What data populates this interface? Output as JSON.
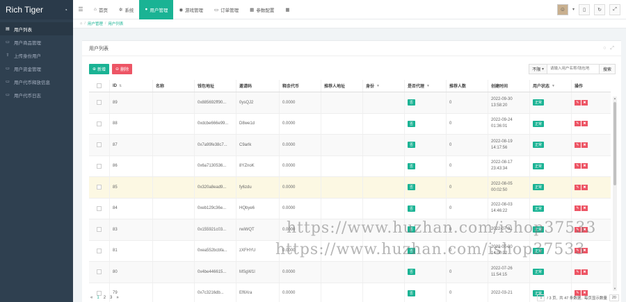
{
  "sidebar": {
    "brand": "Rich Tiger",
    "items": [
      {
        "label": "用户列表",
        "icon": "list-icon",
        "glyph": "▤",
        "active": true
      },
      {
        "label": "用户商品管理",
        "icon": "file-icon",
        "glyph": "▭",
        "active": false
      },
      {
        "label": "上传身份用户",
        "icon": "upload-icon",
        "glyph": "⇧",
        "active": false
      },
      {
        "label": "用户资金管理",
        "icon": "wallet-icon",
        "glyph": "▭",
        "active": false
      },
      {
        "label": "用户代币释放信息",
        "icon": "coin-icon",
        "glyph": "▭",
        "active": false
      },
      {
        "label": "用户代币日志",
        "icon": "log-icon",
        "glyph": "▭",
        "active": false
      }
    ]
  },
  "topnav": {
    "tabs": [
      {
        "label": "首页",
        "icon": "home-icon",
        "glyph": "⌂",
        "active": false
      },
      {
        "label": "系统",
        "icon": "gear-icon",
        "glyph": "✲",
        "active": false
      },
      {
        "label": "用户管理",
        "icon": "user-icon",
        "glyph": "●",
        "active": true
      },
      {
        "label": "游戏管理",
        "icon": "game-icon",
        "glyph": "◉",
        "active": false
      },
      {
        "label": "订单管理",
        "icon": "order-icon",
        "glyph": "▭",
        "active": false
      },
      {
        "label": "参数配置",
        "icon": "config-icon",
        "glyph": "▦",
        "active": false
      },
      {
        "label": "",
        "icon": "grid-icon",
        "glyph": "▦",
        "active": false
      }
    ]
  },
  "breadcrumb": {
    "items": [
      "用户管理",
      "用户列表"
    ]
  },
  "panel": {
    "title": "用户列表"
  },
  "toolbar": {
    "add_label": "新增",
    "delete_label": "删除",
    "select_value": "不限",
    "search_placeholder": "请输入用户名称/钱包地",
    "search_label": "搜索"
  },
  "table": {
    "headers": [
      "ID",
      "名称",
      "钱包地址",
      "邀请码",
      "释余代币",
      "推荐人地址",
      "身份",
      "是否代理",
      "推荐人数",
      "创建时间",
      "用户状态",
      "操作"
    ],
    "rows": [
      {
        "id": "89",
        "name": "",
        "wallet": "0x885692ff90...",
        "code": "0ysQJ2",
        "tokens": "0.0000",
        "ref": "",
        "identity": "",
        "agent": "否",
        "count": "0",
        "date": "2022-09-30",
        "time": "13:58:20",
        "status": "正常"
      },
      {
        "id": "88",
        "name": "",
        "wallet": "0xdcbe666e99...",
        "code": "D8we1d",
        "tokens": "0.0000",
        "ref": "",
        "identity": "",
        "agent": "否",
        "count": "0",
        "date": "2022-09-24",
        "time": "01:36:01",
        "status": "正常"
      },
      {
        "id": "87",
        "name": "",
        "wallet": "0x7a99fe38c7...",
        "code": "C9arlk",
        "tokens": "0.0000",
        "ref": "",
        "identity": "",
        "agent": "否",
        "count": "0",
        "date": "2022-08-19",
        "time": "14:17:56",
        "status": "正常"
      },
      {
        "id": "86",
        "name": "",
        "wallet": "0x6a7130536...",
        "code": "8YZnoK",
        "tokens": "0.0000",
        "ref": "",
        "identity": "",
        "agent": "否",
        "count": "0",
        "date": "2022-08-17",
        "time": "23:43:34",
        "status": "正常"
      },
      {
        "id": "85",
        "name": "",
        "wallet": "0x320a8ead9...",
        "code": "fy6zdu",
        "tokens": "0.0000",
        "ref": "",
        "identity": "",
        "agent": "否",
        "count": "0",
        "date": "2022-08-05",
        "time": "00:02:50",
        "status": "正常"
      },
      {
        "id": "84",
        "name": "",
        "wallet": "0xeb129c36e...",
        "code": "HQbye6",
        "tokens": "0.0000",
        "ref": "",
        "identity": "",
        "agent": "否",
        "count": "0",
        "date": "2022-08-03",
        "time": "14:46:22",
        "status": "正常"
      },
      {
        "id": "83",
        "name": "",
        "wallet": "0x155921c03...",
        "code": "rwiWQT",
        "tokens": "0.0000",
        "ref": "",
        "identity": "",
        "agent": "否",
        "count": "0",
        "date": "2022-07-31",
        "time": "",
        "status": "正常"
      },
      {
        "id": "81",
        "name": "",
        "wallet": "0xea552bcbfa...",
        "code": "zXFHYU",
        "tokens": "0.0000",
        "ref": "",
        "identity": "",
        "agent": "否",
        "count": "0",
        "date": "2022-07-30",
        "time": "14:00:02",
        "status": "正常"
      },
      {
        "id": "80",
        "name": "",
        "wallet": "0x4be446615...",
        "code": "MSgW1l",
        "tokens": "0.0000",
        "ref": "",
        "identity": "",
        "agent": "否",
        "count": "0",
        "date": "2022-07-26",
        "time": "11:54:15",
        "status": "正常"
      },
      {
        "id": "79",
        "name": "",
        "wallet": "0x7c3216db...",
        "code": "Ef6Xra",
        "tokens": "0.0000",
        "ref": "",
        "identity": "",
        "agent": "否",
        "count": "0",
        "date": "2022-03-21",
        "time": "",
        "status": "正常"
      }
    ]
  },
  "pager": {
    "prev": "«",
    "pages": [
      "1",
      "2",
      "3"
    ],
    "next": "»",
    "current_page": "1",
    "total_pages": "/ 3 页,",
    "total_label": "共 47 条数据,",
    "per_page_label": "每页显示数量",
    "per_page": "20"
  },
  "watermark": "https://www.huzhan.com/ishop37533"
}
